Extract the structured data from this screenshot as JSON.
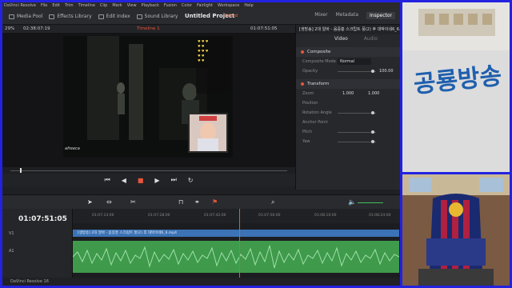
{
  "menu": [
    "DaVinci Resolve",
    "File",
    "Edit",
    "Trim",
    "Timeline",
    "Clip",
    "Mark",
    "View",
    "Playback",
    "Fusion",
    "Color",
    "Fairlight",
    "Workspace",
    "Help"
  ],
  "toolbar": {
    "media_pool": "Media Pool",
    "effects_library": "Effects Library",
    "edit_index": "Edit Index",
    "sound_library": "Sound Library",
    "project_title": "Untitled Project",
    "edited_badge": "Edited",
    "mixer": "Mixer",
    "metadata": "Metadata",
    "inspector": "Inspector"
  },
  "viewer": {
    "zoom": "29%",
    "source_timecode": "02:38:07:19",
    "timeline_name": "Timeline 1",
    "record_timecode": "01:07:51:05",
    "watermark": "afreeca"
  },
  "inspector": {
    "clip_name": "[생방송] 2대 알바 - 음증흥 스크립트 풍(2) 후 대박이네6_6.mp4",
    "tabs": [
      "Video",
      "Audio"
    ],
    "composite_header": "Composite",
    "composite_mode_label": "Composite Mode",
    "composite_mode_value": "Normal",
    "opacity_label": "Opacity",
    "opacity_value": "100.00",
    "transform_header": "Transform",
    "zoom_label": "Zoom",
    "zoom_x": "1.000",
    "zoom_y": "1.000",
    "position_label": "Position",
    "rotation_label": "Rotation Angle",
    "anchor_label": "Anchor Point",
    "pitch_label": "Pitch",
    "yaw_label": "Yaw"
  },
  "timeline": {
    "timecode": "01:07:51:05",
    "ruler_marks": [
      "01:07:14:00",
      "01:07:28:00",
      "01:07:42:00",
      "01:07:56:00",
      "01:08:10:00",
      "01:08:24:00"
    ],
    "video_clip_name": "[생방송] 2대 알바 - 음증흥 스크립트 풍(2) 후 대박이네6_6.mp4",
    "track_v1": "V1",
    "track_a1": "A1"
  },
  "status": {
    "app_version": "DaVinci Resolve 16"
  },
  "webcam": {
    "banner_text": "공룡방송"
  },
  "colors": {
    "accent": "#e8553a",
    "video_clip": "#3b73b6",
    "audio_clip": "#3f9a4c",
    "frame_blue": "#2222e0"
  }
}
